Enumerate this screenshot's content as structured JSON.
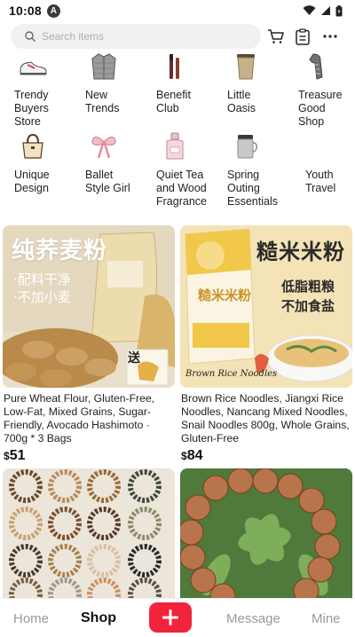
{
  "status_bar": {
    "time": "10:08",
    "notification_letter": "A"
  },
  "search": {
    "placeholder": "Search items"
  },
  "categories": [
    {
      "label": "Trendy Buyers Store",
      "icon": "sneaker-icon"
    },
    {
      "label": "New Trends",
      "icon": "jacket-icon"
    },
    {
      "label": "Benefit Club",
      "icon": "mascara-icon"
    },
    {
      "label": "Little Oasis",
      "icon": "tumbler-cup-icon"
    },
    {
      "label": "Treasure Good Shop",
      "icon": "scarf-icon"
    },
    {
      "label": "Unique Design",
      "icon": "handbag-icon"
    },
    {
      "label": "Ballet Style Girl",
      "icon": "bow-ribbon-icon"
    },
    {
      "label": "Quiet Tea and Wood Fragrance",
      "icon": "perfume-bottle-icon"
    },
    {
      "label": "Spring Outing Essentials",
      "icon": "travel-mug-icon"
    },
    {
      "label": "Youth Travel",
      "icon": ""
    }
  ],
  "products": [
    {
      "title": "Pure Wheat Flour, Gluten-Free, Low-Fat, Mixed Grains, Sugar-Friendly, Avocado Hashimoto · 700g * 3 Bags",
      "currency": "$",
      "price": "51",
      "image_text": {
        "headline": "纯荞麦粉",
        "line1": "·配料干净",
        "line2": "·不加小麦",
        "badge": "送"
      }
    },
    {
      "title": "Brown Rice Noodles, Jiangxi Rice Noodles, Nancang Mixed Noodles, Snail Noodles 800g, Whole Grains, Gluten-Free",
      "currency": "$",
      "price": "84",
      "image_text": {
        "headline": "糙米米粉",
        "line1": "低脂粗粮",
        "line2": "不加食盐",
        "package": "糙米米粉",
        "script": "Brown Rice Noodles"
      }
    },
    {
      "title": "",
      "currency": "",
      "price": ""
    },
    {
      "title": "",
      "currency": "",
      "price": ""
    }
  ],
  "bottom_nav": {
    "home": "Home",
    "shop": "Shop",
    "message": "Message",
    "mine": "Mine",
    "active": "Shop"
  },
  "colors": {
    "accent": "#f2243c",
    "search_bg": "#f1f1f1"
  }
}
